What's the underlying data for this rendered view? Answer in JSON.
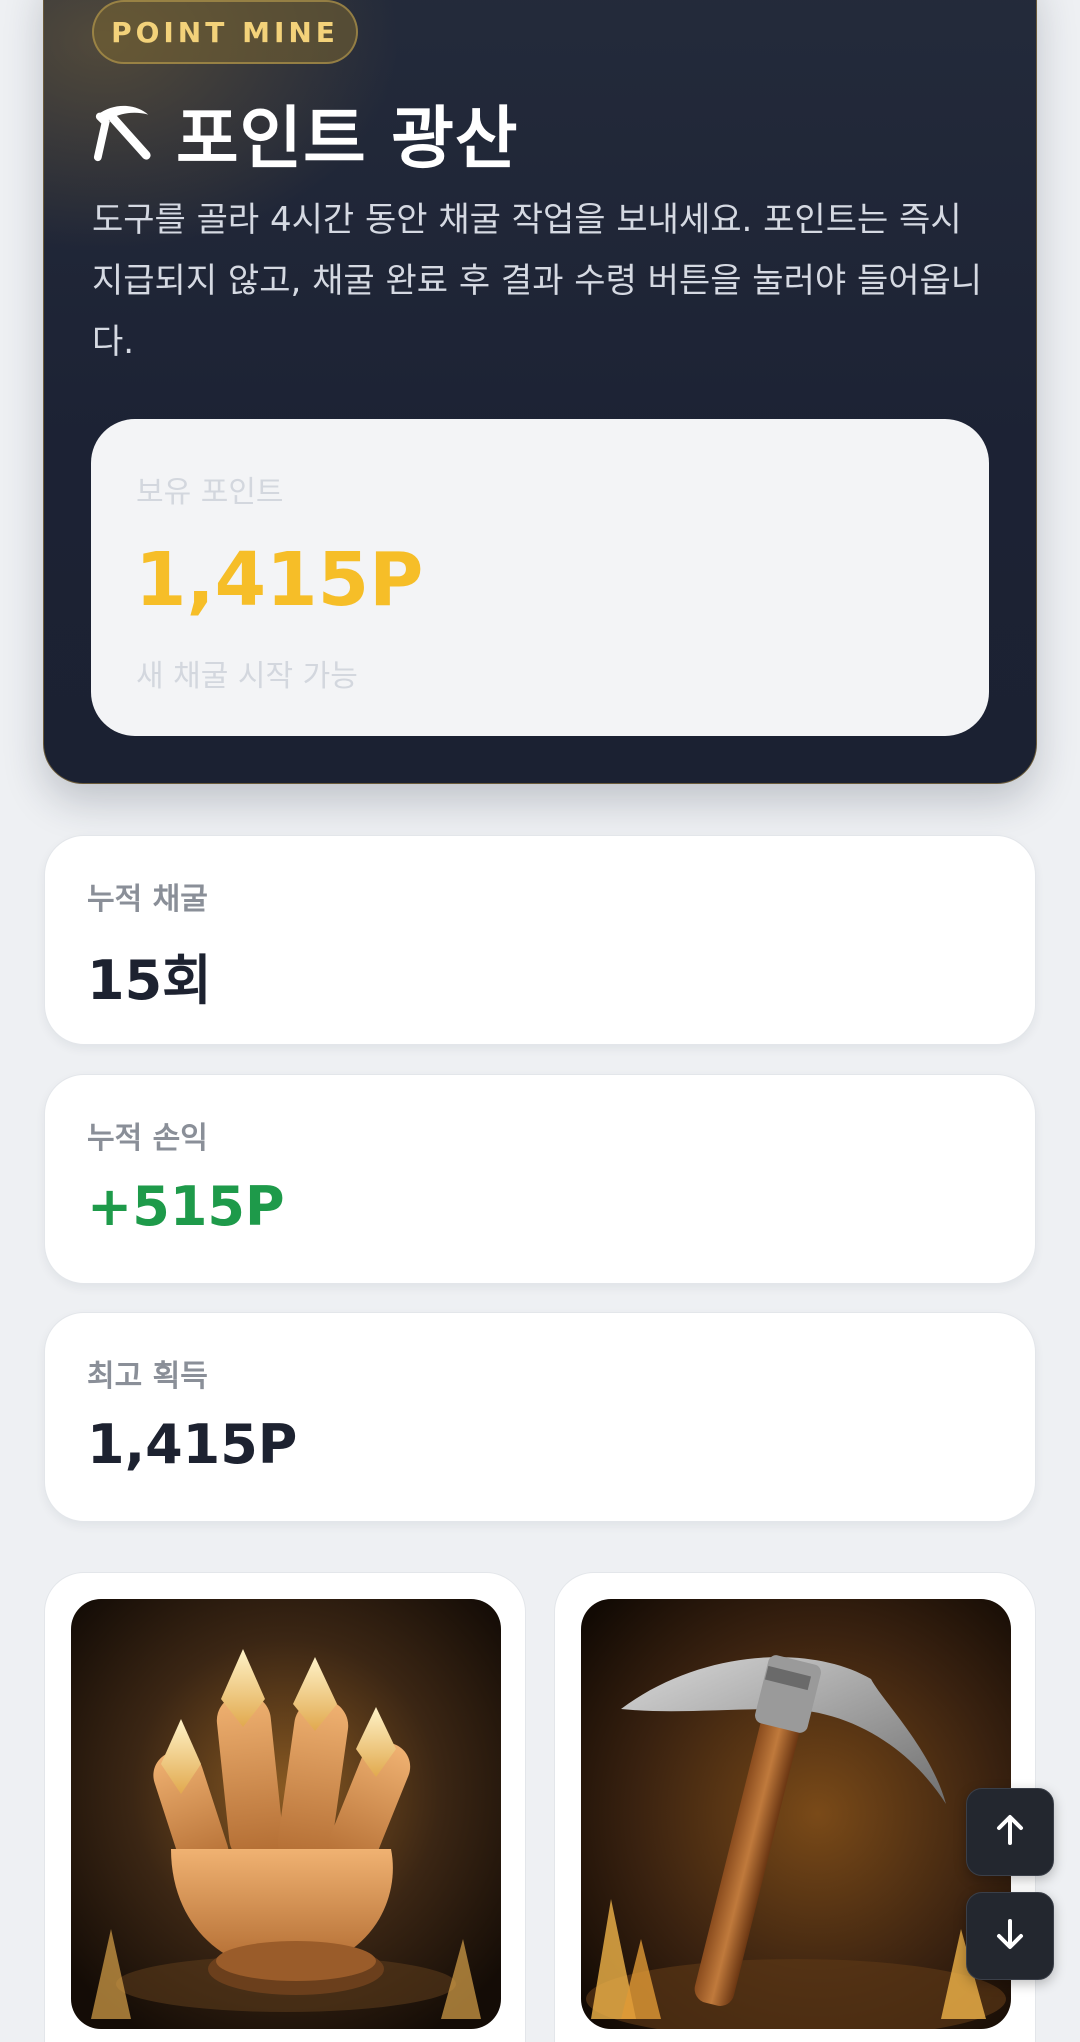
{
  "hero": {
    "badge": "POINT MINE",
    "title": "포인트 광산",
    "title_icon": "pickaxe-icon",
    "description": "도구를 골라 4시간 동안 채굴 작업을 보내세요. 포인트는 즉시 지급되지 않고, 채굴 완료 후 결과 수령 버튼을 눌러야 들어옵니다."
  },
  "balance": {
    "label": "보유 포인트",
    "value": "1,415P",
    "sub": "새 채굴 시작 가능"
  },
  "stats": [
    {
      "label": "누적 채굴",
      "value": "15회"
    },
    {
      "label": "누적 손익",
      "value": "+515P"
    },
    {
      "label": "최고 획득",
      "value": "1,415P"
    }
  ],
  "tools": [
    {
      "image": "crystal-glove-image"
    },
    {
      "image": "pickaxe-image"
    }
  ],
  "scroll": {
    "up_icon": "arrow-up-icon",
    "down_icon": "arrow-down-icon"
  },
  "colors": {
    "hero_bg": "#1c2234",
    "gold": "#f6be28",
    "positive": "#1e9a4a",
    "text_dark": "#1d2230",
    "label_gray": "#8a8f98"
  }
}
